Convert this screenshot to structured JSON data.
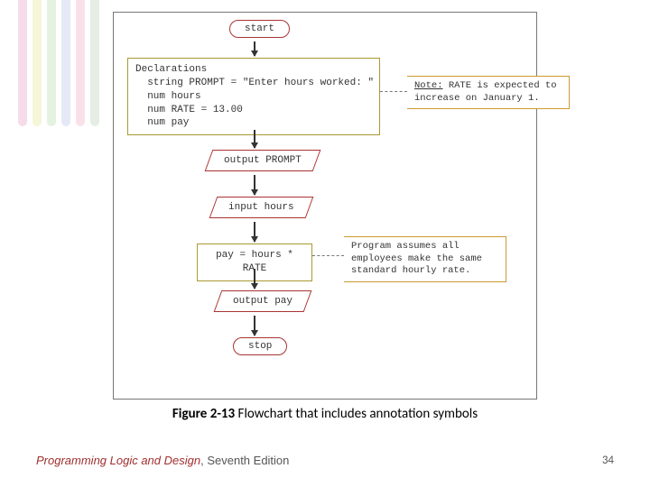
{
  "caption": {
    "label": "Figure 2-13",
    "text": " Flowchart that includes annotation symbols"
  },
  "footer": {
    "book": "Programming Logic and Design",
    "edition": ", Seventh Edition",
    "page": "34"
  },
  "flow": {
    "start": "start",
    "decl_l1": "Declarations",
    "decl_l2": "  string PROMPT = \"Enter hours worked: \"",
    "decl_l3": "  num hours",
    "decl_l4": "  num RATE = 13.00",
    "decl_l5": "  num pay",
    "out_prompt": "output PROMPT",
    "in_hours": "input hours",
    "calc": "pay = hours * RATE",
    "out_pay": "output pay",
    "stop": "stop",
    "annot1_label": "Note:",
    "annot1_text": " RATE is expected to increase on January 1.",
    "annot2": "Program assumes all employees make the same standard hourly rate."
  }
}
